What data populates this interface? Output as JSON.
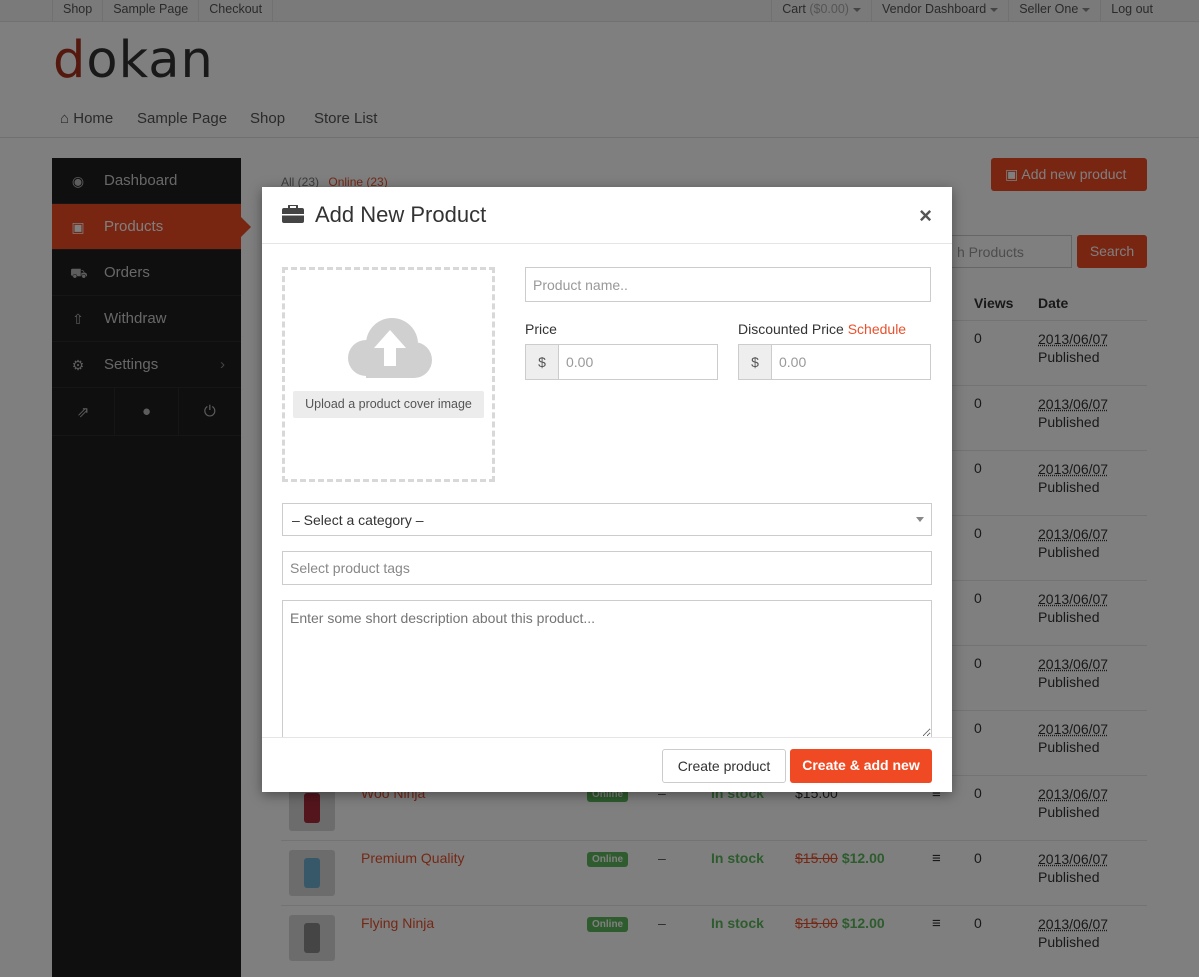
{
  "topbar": {
    "left": [
      "Shop",
      "Sample Page",
      "Checkout"
    ],
    "cart_label": "Cart",
    "cart_amount": "($0.00)",
    "vendor_dashboard": "Vendor Dashboard",
    "seller": "Seller One",
    "logout": "Log out"
  },
  "logo": {
    "first": "d",
    "rest": "okan"
  },
  "nav": {
    "home": "Home",
    "sample": "Sample Page",
    "shop": "Shop",
    "stores": "Store List"
  },
  "sidebar": {
    "dashboard": "Dashboard",
    "products": "Products",
    "orders": "Orders",
    "withdraw": "Withdraw",
    "settings": "Settings"
  },
  "filters": {
    "all": "All (23)",
    "online": "Online (23)"
  },
  "toolbar": {
    "add_product": "Add new product",
    "search_placeholder": "h Products",
    "search": "Search"
  },
  "table": {
    "headers": {
      "views": "Views",
      "date": "Date"
    },
    "rows": [
      {
        "name": "",
        "status": "",
        "stock": "",
        "price_old": "",
        "price": "",
        "views": "0",
        "date": "2013/06/07",
        "state": "Published"
      },
      {
        "name": "",
        "status": "",
        "stock": "",
        "price_old": "",
        "price": "",
        "views": "0",
        "date": "2013/06/07",
        "state": "Published"
      },
      {
        "name": "",
        "status": "",
        "stock": "",
        "price_old": "",
        "price": "",
        "views": "0",
        "date": "2013/06/07",
        "state": "Published"
      },
      {
        "name": "",
        "status": "",
        "stock": "",
        "price_old": "",
        "price": "",
        "views": "0",
        "date": "2013/06/07",
        "state": "Published"
      },
      {
        "name": "",
        "status": "",
        "stock": "",
        "price_old": "",
        "price": "",
        "views": "0",
        "date": "2013/06/07",
        "state": "Published"
      },
      {
        "name": "",
        "status": "",
        "stock": "",
        "price_old": "",
        "price": "",
        "views": "0",
        "date": "2013/06/07",
        "state": "Published"
      },
      {
        "name": "",
        "status": "",
        "stock": "",
        "price_old": "",
        "price": "",
        "views": "0",
        "date": "2013/06/07",
        "state": "Published"
      },
      {
        "name": "Woo Ninja",
        "status": "Online",
        "dash": "–",
        "stock": "In stock",
        "price_old": "",
        "price": "$15.00",
        "views": "0",
        "date": "2013/06/07",
        "state": "Published"
      },
      {
        "name": "Premium Quality",
        "status": "Online",
        "dash": "–",
        "stock": "In stock",
        "price_old": "$15.00",
        "price": "$12.00",
        "views": "0",
        "date": "2013/06/07",
        "state": "Published"
      },
      {
        "name": "Flying Ninja",
        "status": "Online",
        "dash": "–",
        "stock": "In stock",
        "price_old": "$15.00",
        "price": "$12.00",
        "views": "0",
        "date": "2013/06/07",
        "state": "Published"
      }
    ]
  },
  "modal": {
    "title": "Add New Product",
    "close": "×",
    "upload_label": "Upload a product cover image",
    "product_name_placeholder": "Product name..",
    "price_label": "Price",
    "discount_label": "Discounted Price",
    "schedule_label": "Schedule",
    "currency": "$",
    "price_placeholder": "0.00",
    "discount_placeholder": "0.00",
    "category_selected": "– Select a category –",
    "tags_placeholder": "Select product tags",
    "description_placeholder": "Enter some short description about this product...",
    "create": "Create product",
    "create_new": "Create & add new"
  },
  "colors": {
    "accent": "#f04a25",
    "sidebar": "#1e1e1e",
    "success": "#5cb85c"
  }
}
